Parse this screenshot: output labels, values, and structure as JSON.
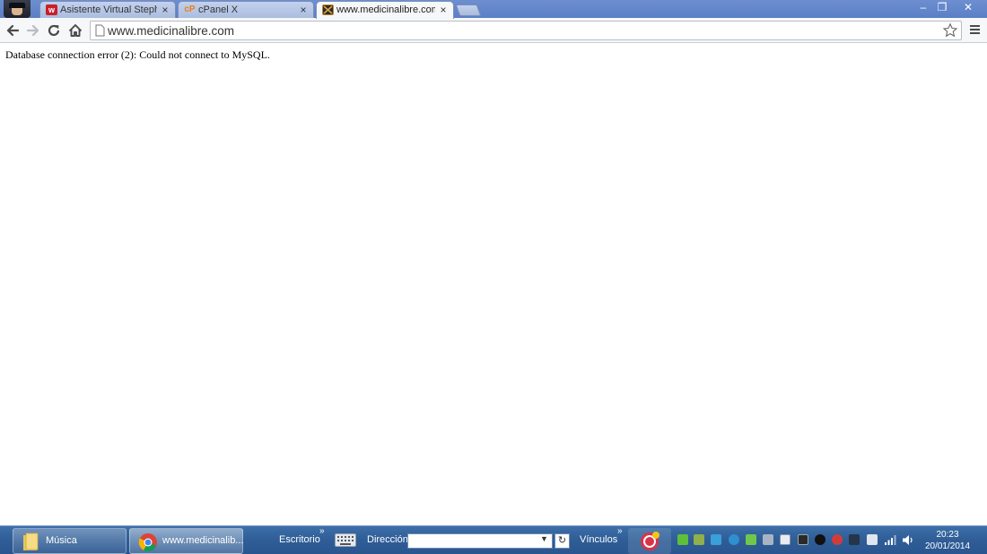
{
  "tabs": [
    {
      "title": "Asistente Virtual Stephan C",
      "favicon": "red-w-icon",
      "close": "×"
    },
    {
      "title": "cPanel X",
      "favicon": "cpanel-icon",
      "close": "×"
    },
    {
      "title": "www.medicinalibre.com",
      "favicon": "medicinalibre-icon",
      "close": "×"
    }
  ],
  "window_controls": {
    "minimize": "–",
    "maximize": "❐",
    "close": "✕"
  },
  "address_bar": {
    "url": "www.medicinalibre.com"
  },
  "page": {
    "error_message": "Database connection error (2): Could not connect to MySQL."
  },
  "taskbar": {
    "items": [
      {
        "label": "Música",
        "icon": "folder-icon"
      },
      {
        "label": "www.medicinalib...",
        "icon": "chrome-icon"
      }
    ],
    "desktop_label": "Escritorio",
    "address_label": "Dirección",
    "address_value": "",
    "links_label": "Vínculos",
    "chevron": "»",
    "time": "20:23",
    "date": "20/01/2014"
  },
  "colors": {
    "tab_strip": "#5b7fc6",
    "taskbar": "#2f5d96",
    "cpanel_orange": "#f07c16"
  }
}
